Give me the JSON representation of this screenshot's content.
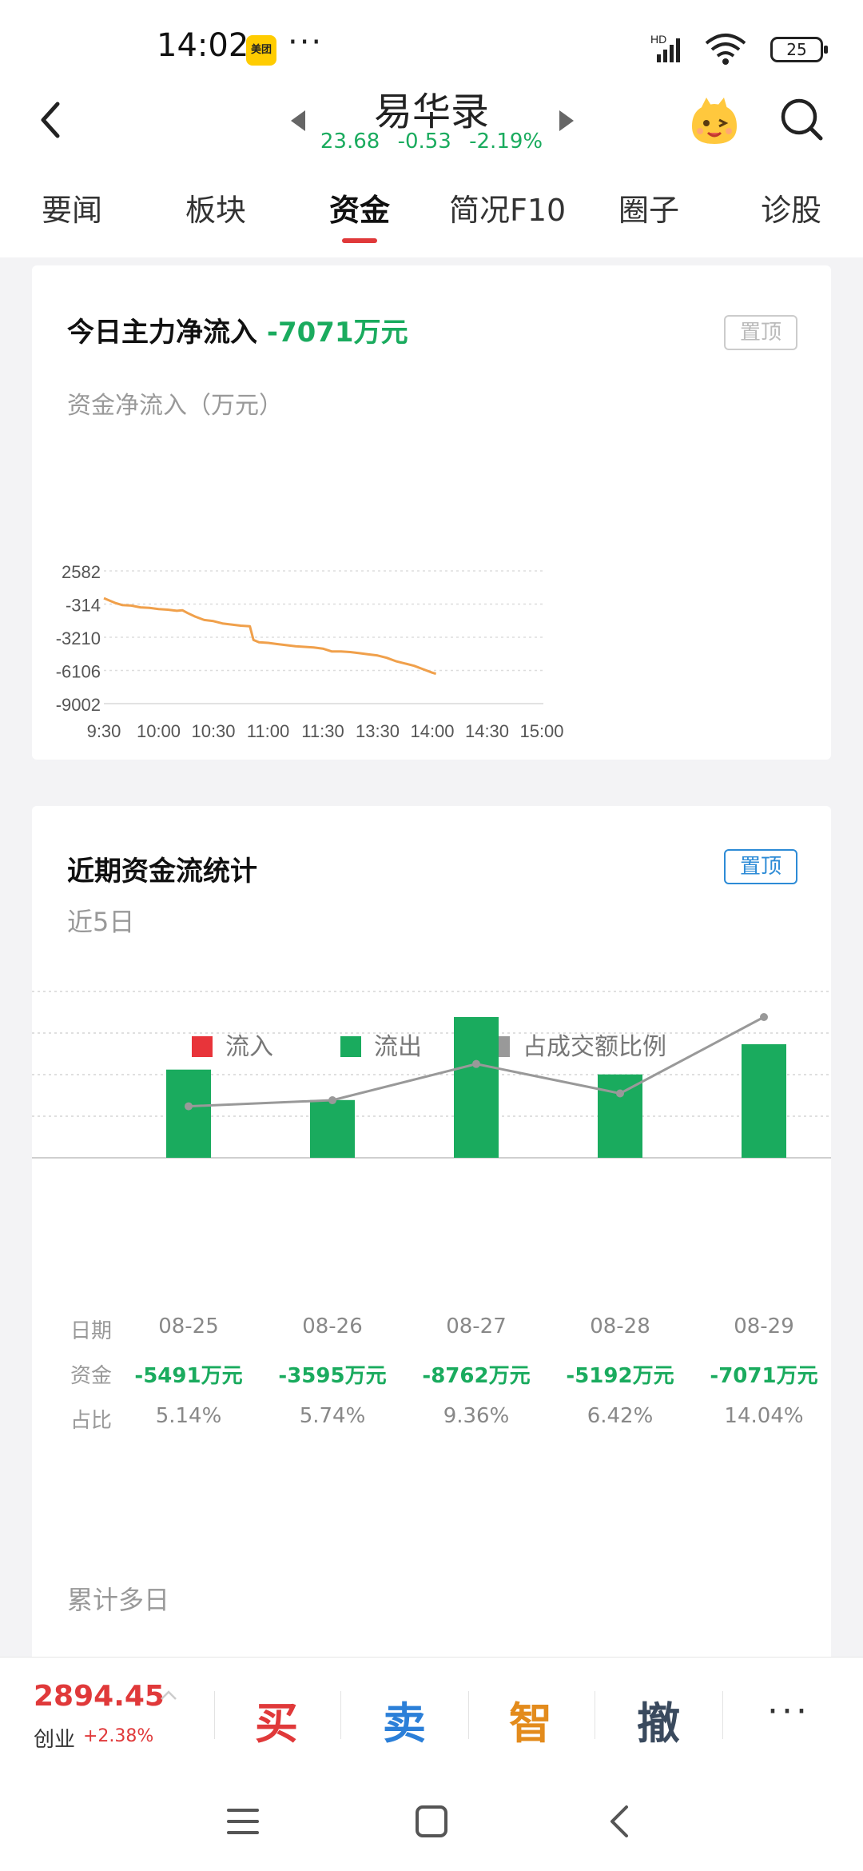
{
  "status_bar": {
    "time": "14:02",
    "app_badge": "美团",
    "dots": "···",
    "network": "HD",
    "battery": "25"
  },
  "header": {
    "stock_name": "易华录",
    "price": "23.68",
    "change": "-0.53",
    "change_pct": "-2.19%"
  },
  "tabs": [
    {
      "label": "要闻"
    },
    {
      "label": "板块"
    },
    {
      "label": "资金"
    },
    {
      "label": "简况F10"
    },
    {
      "label": "圈子"
    },
    {
      "label": "诊股"
    }
  ],
  "active_tab": "资金",
  "main_flow": {
    "title": "今日主力净流入",
    "value": "-7071万元",
    "pin_label": "置顶",
    "subtitle": "资金净流入（万元）"
  },
  "recent_flow": {
    "title": "近期资金流统计",
    "pin_label": "置顶",
    "period_label": "近5日",
    "legend": [
      {
        "label": "流入",
        "color": "#e8343a"
      },
      {
        "label": "流出",
        "color": "#1aab5e"
      },
      {
        "label": "占成交额比例",
        "color": "#999999"
      }
    ],
    "row_labels": {
      "date": "日期",
      "fund": "资金",
      "ratio": "占比"
    },
    "days": [
      {
        "date": "08-25",
        "fund": "-5491万元",
        "ratio": "5.14%"
      },
      {
        "date": "08-26",
        "fund": "-3595万元",
        "ratio": "5.74%"
      },
      {
        "date": "08-27",
        "fund": "-8762万元",
        "ratio": "9.36%"
      },
      {
        "date": "08-28",
        "fund": "-5192万元",
        "ratio": "6.42%"
      },
      {
        "date": "08-29",
        "fund": "-7071万元",
        "ratio": "14.04%"
      }
    ],
    "cumulative_label": "累计多日"
  },
  "chart_data": [
    {
      "type": "line",
      "ylabel": "资金净流入（万元）",
      "y_ticks": [
        2582,
        -314,
        -3210,
        -6106,
        -9002
      ],
      "ylim": [
        -9002,
        2582
      ],
      "x_ticks": [
        "9:30",
        "10:00",
        "10:30",
        "11:00",
        "11:30",
        "13:30",
        "14:00",
        "14:30",
        "15:00"
      ],
      "grid": true,
      "series": [
        {
          "color": "#f0a04b",
          "points": [
            [
              "9:30",
              200
            ],
            [
              "9:33",
              0
            ],
            [
              "9:36",
              -200
            ],
            [
              "9:40",
              -400
            ],
            [
              "9:45",
              -450
            ],
            [
              "9:50",
              -600
            ],
            [
              "9:55",
              -650
            ],
            [
              "10:00",
              -750
            ],
            [
              "10:05",
              -800
            ],
            [
              "10:10",
              -900
            ],
            [
              "10:13",
              -850
            ],
            [
              "10:16",
              -1100
            ],
            [
              "10:20",
              -1400
            ],
            [
              "10:25",
              -1700
            ],
            [
              "10:30",
              -1800
            ],
            [
              "10:35",
              -2000
            ],
            [
              "10:40",
              -2100
            ],
            [
              "10:45",
              -2200
            ],
            [
              "10:50",
              -2250
            ],
            [
              "10:52",
              -3450
            ],
            [
              "10:55",
              -3650
            ],
            [
              "11:00",
              -3700
            ],
            [
              "11:05",
              -3800
            ],
            [
              "11:10",
              -3900
            ],
            [
              "11:15",
              -4000
            ],
            [
              "11:20",
              -4050
            ],
            [
              "11:25",
              -4100
            ],
            [
              "11:30",
              -4200
            ],
            [
              "13:05",
              -4450
            ],
            [
              "13:10",
              -4450
            ],
            [
              "13:15",
              -4500
            ],
            [
              "13:20",
              -4600
            ],
            [
              "13:25",
              -4700
            ],
            [
              "13:30",
              -4800
            ],
            [
              "13:35",
              -5000
            ],
            [
              "13:40",
              -5300
            ],
            [
              "13:45",
              -5500
            ],
            [
              "13:50",
              -5700
            ],
            [
              "13:55",
              -6000
            ],
            [
              "14:00",
              -6300
            ],
            [
              "14:02",
              -6400
            ]
          ]
        }
      ]
    },
    {
      "type": "bar",
      "categories": [
        "08-25",
        "08-26",
        "08-27",
        "08-28",
        "08-29"
      ],
      "series": [
        {
          "name": "流出",
          "color": "#1aab5e",
          "values": [
            -5491,
            -3595,
            -8762,
            -5192,
            -7071
          ]
        },
        {
          "name": "占成交额比例",
          "type": "line",
          "color": "#999999",
          "values": [
            5.14,
            5.74,
            9.36,
            6.42,
            14.04
          ]
        }
      ],
      "grid": true,
      "legend": "top-center"
    }
  ],
  "trade_bar": {
    "index_value": "2894.45",
    "index_name": "创业",
    "index_change": "+2.38%",
    "buy": "买",
    "sell": "卖",
    "smart": "智",
    "cancel": "撤",
    "more": "···"
  }
}
